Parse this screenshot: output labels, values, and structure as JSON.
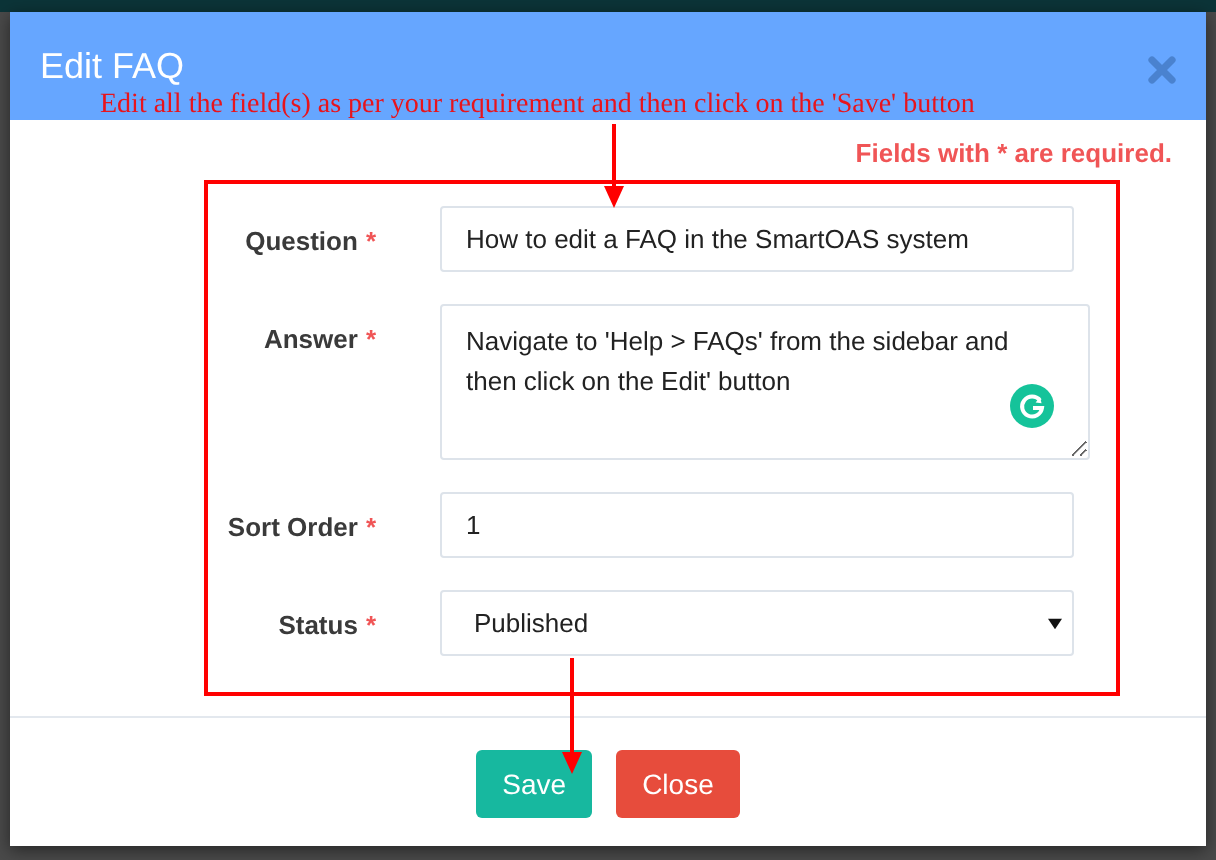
{
  "dialog": {
    "title": "Edit FAQ"
  },
  "required_note": "Fields with * are required.",
  "fields": [
    {
      "label": "Question",
      "marker": "*",
      "kind": "text",
      "value": "How to edit a FAQ in the SmartOAS system"
    },
    {
      "label": "Answer",
      "marker": "*",
      "kind": "textarea",
      "value": "Navigate to 'Help > FAQs' from the sidebar and then click on the Edit' button"
    },
    {
      "label": "Sort Order",
      "marker": "*",
      "kind": "text",
      "value": "1"
    },
    {
      "label": "Status",
      "marker": "*",
      "kind": "select",
      "value": "Published"
    }
  ],
  "buttons": [
    {
      "label": "Save",
      "kind": "success"
    },
    {
      "label": "Close",
      "kind": "danger"
    }
  ],
  "annotation": {
    "text": "Edit all the field(s) as per your requirement and then click on the 'Save' button"
  }
}
